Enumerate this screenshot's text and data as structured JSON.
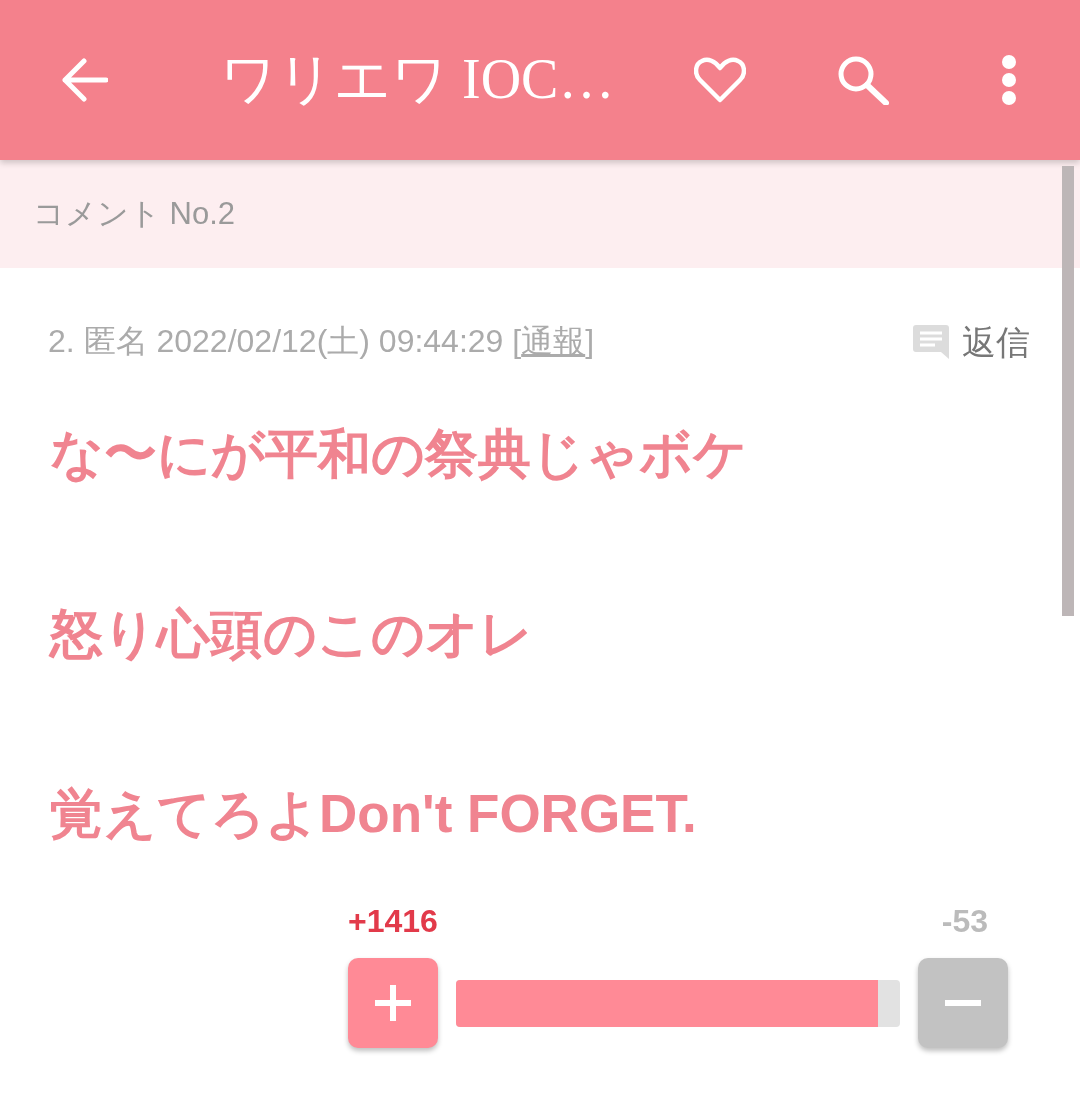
{
  "app_bar": {
    "title": "ワリエワ IOC…"
  },
  "section_header": {
    "label": "コメント No.2"
  },
  "comment": {
    "meta_prefix": "2. 匿名 2022/02/12(土) 09:44:29 [",
    "report_link": "通報",
    "meta_suffix": "]",
    "reply_label": "返信",
    "body_lines": [
      "な〜にが平和の祭典じゃボケ",
      "怒り心頭のこのオレ",
      "覚えてろよDon't FORGET."
    ]
  },
  "votes": {
    "plus_count": "+1416",
    "minus_count": "-53",
    "level": 0.95
  }
}
